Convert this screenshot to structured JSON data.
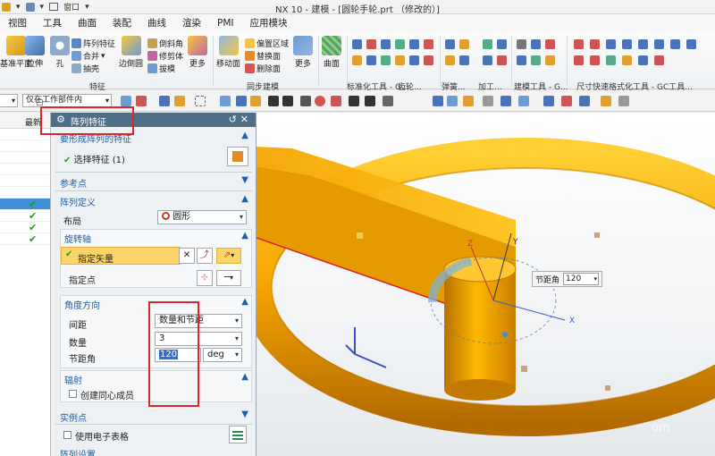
{
  "titlebar": {
    "window_menu": "窗口",
    "title": "NX 10 - 建模 - [圆轮手轮.prt （修改的）]"
  },
  "menus": [
    "视图",
    "工具",
    "曲面",
    "装配",
    "曲线",
    "渲染",
    "PMI",
    "应用模块"
  ],
  "ribbon": {
    "buttons": {
      "datum_plane": "基准平面",
      "extrude": "拉伸",
      "hole": "孔",
      "shell": "抽壳",
      "edge_blend": "边倒圆",
      "more_feature": "更多",
      "move_face": "移动面",
      "more_sync": "更多",
      "surface": "曲面"
    },
    "small": {
      "pattern_feature": "阵列特征",
      "combine": "合并",
      "chamfer": "倒斜角",
      "trim_body": "修剪体",
      "draft": "拔模",
      "offset_region": "偏置区域",
      "replace_face": "替换面",
      "delete_face": "删除面"
    },
    "groups": {
      "feature": "特征",
      "sync": "同步建模",
      "standard_tools": "标准化工具 - G...",
      "gear": "齿轮...",
      "spring": "弹簧...",
      "machining": "加工...",
      "build": "建模工具 - G...",
      "dim": "尺寸快速格式化工具 - GC工具..."
    }
  },
  "selection_bar": {
    "filter_value": "仅在工作部件内"
  },
  "navigator": {
    "column_latest": "最新"
  },
  "dialog": {
    "title": "阵列特征",
    "sections": {
      "select_features": "要形成阵列的特征",
      "reference_point": "参考点",
      "pattern_definition": "阵列定义",
      "rotation_axis": "旋转轴",
      "angular_direction": "角度方向",
      "radiate": "辐射",
      "instance_points": "实例点",
      "pattern_settings": "阵列设置"
    },
    "select_feature_label": "选择特征 (1)",
    "layout_label": "布局",
    "layout_value": "圆形",
    "specify_vector_label": "指定矢量",
    "specify_point_label": "指定点",
    "spacing_label": "间距",
    "spacing_value": "数量和节距",
    "count_label": "数量",
    "count_value": "3",
    "pitch_angle_label": "节距角",
    "pitch_angle_value": "120",
    "unit": "deg",
    "create_concentric_label": "创建同心成员",
    "use_spreadsheet_label": "使用电子表格"
  },
  "viewport": {
    "pitch_label": "节距角",
    "pitch_value": "120",
    "axis_x": "X",
    "axis_y": "Y",
    "axis_z": "Z",
    "watermark": "om"
  },
  "colors": {
    "ring": "#f5a400",
    "dialog_header": "#4f6f86",
    "highlight": "#e0242c",
    "vector_row": "#fbd56a",
    "selected_row": "#3d8fd6"
  }
}
